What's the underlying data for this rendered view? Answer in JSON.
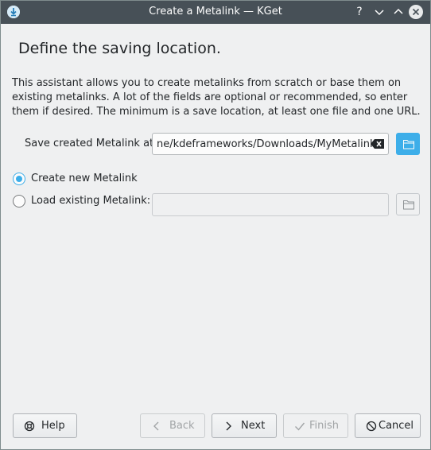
{
  "window": {
    "title": "Create a Metalink — KGet",
    "controls": {
      "help": "?",
      "minimize": "⌄",
      "maximize": "⌃",
      "close": "✕"
    }
  },
  "page": {
    "heading": "Define the saving location.",
    "description": "This assistant allows you to create metalinks from scratch or base them on existing metalinks. A lot of the fields are optional or recommended, so enter them if desired. The minimum is a save location, at least one file and one URL."
  },
  "save": {
    "label": "Save created Metalink at:",
    "value": "ne/kdeframeworks/Downloads/MyMetalink"
  },
  "options": {
    "create_new": {
      "label": "Create new Metalink",
      "checked": true
    },
    "load_existing": {
      "label": "Load existing Metalink:",
      "checked": false,
      "value": ""
    }
  },
  "buttons": {
    "help": "Help",
    "back": "Back",
    "next": "Next",
    "finish": "Finish",
    "cancel": "Cancel"
  },
  "colors": {
    "accent": "#3daee9",
    "titlebar": "#475057",
    "background": "#eff0f1"
  }
}
